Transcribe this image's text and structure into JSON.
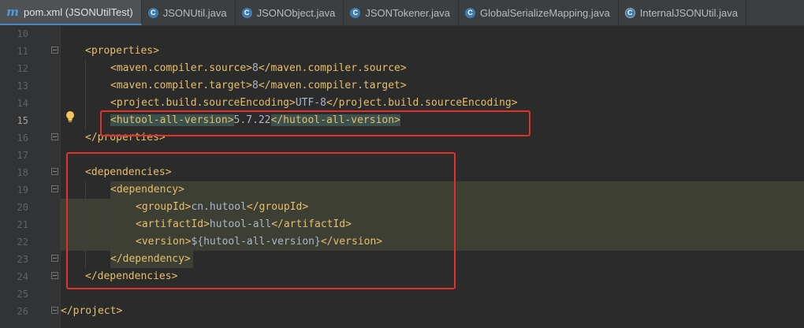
{
  "tabs": [
    {
      "label": "pom.xml (JSONUtilTest)",
      "icon": "maven-icon",
      "active": true
    },
    {
      "label": "JSONUtil.java",
      "icon": "java-class-icon"
    },
    {
      "label": "JSONObject.java",
      "icon": "java-class-icon"
    },
    {
      "label": "JSONTokener.java",
      "icon": "java-class-icon"
    },
    {
      "label": "GlobalSerializeMapping.java",
      "icon": "java-class-icon"
    },
    {
      "label": "InternalJSONUtil.java",
      "icon": "java-class-icon"
    }
  ],
  "current_line": 15,
  "lines": [
    {
      "num": "10"
    },
    {
      "num": "11",
      "open": "<properties>"
    },
    {
      "num": "12",
      "open": "<maven.compiler.source>",
      "value": "8",
      "close": "</maven.compiler.source>"
    },
    {
      "num": "13",
      "open": "<maven.compiler.target>",
      "value": "8",
      "close": "</maven.compiler.target>"
    },
    {
      "num": "14",
      "open": "<project.build.sourceEncoding>",
      "value": "UTF-8",
      "close": "</project.build.sourceEncoding>"
    },
    {
      "num": "15",
      "open": "<hutool-all-version>",
      "value": "5.7.22",
      "close": "</hutool-all-version>"
    },
    {
      "num": "16",
      "close": "</properties>"
    },
    {
      "num": "17"
    },
    {
      "num": "18",
      "open": "<dependencies>"
    },
    {
      "num": "19",
      "open": "<dependency>"
    },
    {
      "num": "20",
      "open": "<groupId>",
      "value": "cn.hutool",
      "close": "</groupId>"
    },
    {
      "num": "21",
      "open": "<artifactId>",
      "value": "hutool-all",
      "close": "</artifactId>"
    },
    {
      "num": "22",
      "open": "<version>",
      "value": "${hutool-all-version}",
      "close": "</version>"
    },
    {
      "num": "23",
      "close": "</dependency>"
    },
    {
      "num": "24",
      "close": "</dependencies>"
    },
    {
      "num": "25"
    },
    {
      "num": "26",
      "close": "</project>"
    }
  ],
  "colors": {
    "tag": "#e8bf6a",
    "text": "#a9b7c6",
    "annotation": "#e0322b",
    "background": "#2b2b2b"
  }
}
